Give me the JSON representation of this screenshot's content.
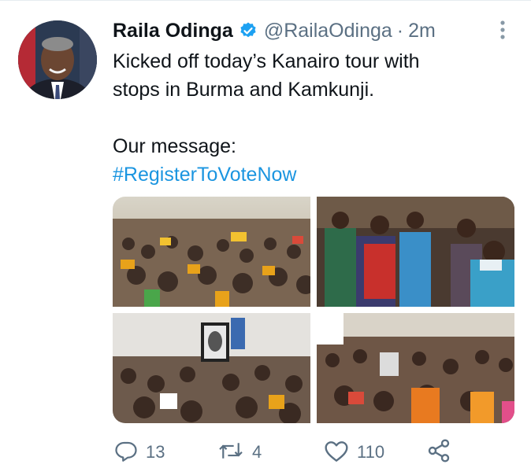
{
  "tweet": {
    "author_name": "Raila Odinga",
    "handle": "@RailaOdinga",
    "separator": "·",
    "time": "2m",
    "text_line1": "Kicked off today’s Kanairo tour with",
    "text_line2": "stops in Burma and Kamkunji.",
    "text_line3": "Our message:",
    "hashtag": "#RegisterToVoteNow"
  },
  "media": [
    {
      "name": "crowd-rally-photo",
      "icon": "photo"
    },
    {
      "name": "supporters-gesturing-photo",
      "icon": "photo"
    },
    {
      "name": "portrait-held-up-photo",
      "icon": "photo"
    },
    {
      "name": "crowd-with-signs-photo",
      "icon": "photo"
    }
  ],
  "actions": {
    "replies": "13",
    "retweets": "4",
    "likes": "110"
  },
  "icons": {
    "verified": "verified-badge-icon",
    "more": "more-vertical-icon",
    "reply": "reply-icon",
    "retweet": "retweet-icon",
    "like": "heart-icon",
    "share": "share-icon"
  },
  "colors": {
    "text": "#0f1419",
    "secondary": "#5b7083",
    "link": "#1b95e0",
    "verified": "#1da1f2"
  }
}
